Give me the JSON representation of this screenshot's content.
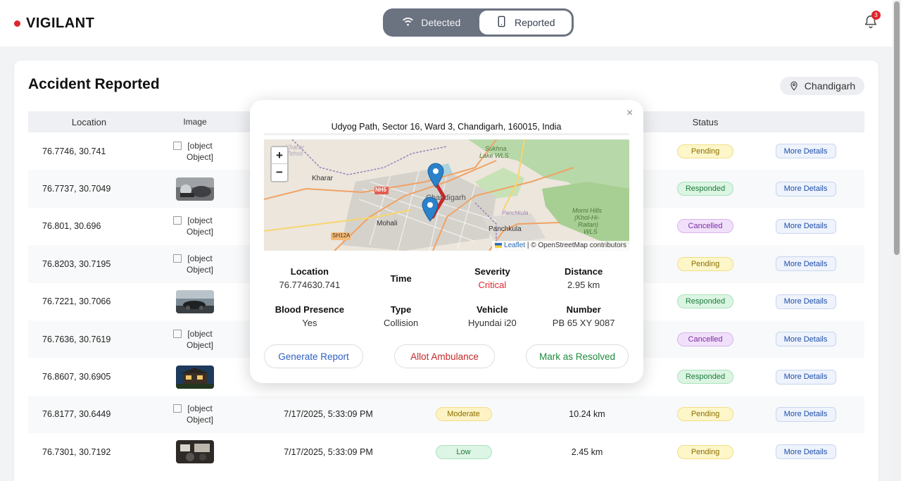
{
  "brand": {
    "name": "VIGILANT",
    "dot_color": "#e0252f"
  },
  "toggle": {
    "detected": {
      "label": "Detected",
      "icon": "wifi-icon"
    },
    "reported": {
      "label": "Reported",
      "icon": "phone-icon"
    }
  },
  "notifications": {
    "count": "3",
    "icon": "bell-icon"
  },
  "main": {
    "title": "Accident Reported",
    "city": "Chandigarh",
    "columns": {
      "location": "Location",
      "image": "Image",
      "status": "Status"
    },
    "rows": [
      {
        "location": "76.7746, 30.741",
        "image_alt": "[object Object]",
        "time": "",
        "severity": "",
        "distance": "",
        "status": "Pending",
        "action": "More Details"
      },
      {
        "location": "76.7737, 30.7049",
        "image_alt": "",
        "time": "",
        "severity": "",
        "distance": "",
        "status": "Responded",
        "action": "More Details"
      },
      {
        "location": "76.801, 30.696",
        "image_alt": "[object Object]",
        "time": "",
        "severity": "",
        "distance": "",
        "status": "Cancelled",
        "action": "More Details"
      },
      {
        "location": "76.8203, 30.7195",
        "image_alt": "[object Object]",
        "time": "",
        "severity": "",
        "distance": "",
        "status": "Pending",
        "action": "More Details"
      },
      {
        "location": "76.7221, 30.7066",
        "image_alt": "",
        "time": "",
        "severity": "",
        "distance": "",
        "status": "Responded",
        "action": "More Details"
      },
      {
        "location": "76.7636, 30.7619",
        "image_alt": "[object Object]",
        "time": "",
        "severity": "",
        "distance": "",
        "status": "Cancelled",
        "action": "More Details"
      },
      {
        "location": "76.8607, 30.6905",
        "image_alt": "",
        "time": "",
        "severity": "",
        "distance": "",
        "status": "Responded",
        "action": "More Details"
      },
      {
        "location": "76.8177, 30.6449",
        "image_alt": "[object Object]",
        "time": "7/17/2025, 5:33:09 PM",
        "severity": "Moderate",
        "distance": "10.24 km",
        "status": "Pending",
        "action": "More Details"
      },
      {
        "location": "76.7301, 30.7192",
        "image_alt": "",
        "time": "7/17/2025, 5:33:09 PM",
        "severity": "Low",
        "distance": "2.45 km",
        "status": "Pending",
        "action": "More Details"
      }
    ]
  },
  "modal": {
    "close": "×",
    "address": "Udyog Path, Sector 16, Ward 3, Chandigarh, 160015, India",
    "map": {
      "zoom_in": "+",
      "zoom_out": "−",
      "attribution_link": "Leaflet",
      "attribution_text": "| © OpenStreetMap contributors",
      "labels": {
        "kharar": "Kharar",
        "nh5": "NH5",
        "chandigarh": "Chandigarh",
        "mohali": "Mohali",
        "sh12a": "SH12A",
        "panchkula": "Panchkula",
        "panchkula_small": "Panchkula",
        "sukhna": "Sukhna",
        "sukhna2": "Lake WLS",
        "morni": "Morni Hills",
        "morni2": "(Khol-Hi-",
        "morni3": "Raitan)",
        "morni4": "WLS",
        "kharar_top": "Kharar",
        "kharar_top2": "Tehsil"
      }
    },
    "info": {
      "location_label": "Location",
      "location_value": "76.774630.741",
      "time_label": "Time",
      "severity_label": "Severity",
      "severity_value": "Critical",
      "distance_label": "Distance",
      "distance_value": "2.95 km",
      "blood_label": "Blood Presence",
      "blood_value": "Yes",
      "type_label": "Type",
      "type_value": "Collision",
      "vehicle_label": "Vehicle",
      "vehicle_value": "Hyundai i20",
      "number_label": "Number",
      "number_value": "PB 65 XY 9087"
    },
    "buttons": {
      "report": "Generate Report",
      "ambulance": "Allot Ambulance",
      "resolve": "Mark as Resolved"
    }
  },
  "colors": {
    "pending_bg": "#fdf6c9",
    "pending_fg": "#8a6d00",
    "responded_bg": "#dcf5e3",
    "responded_fg": "#1c7a3c",
    "cancelled_bg": "#f1e0fa",
    "cancelled_fg": "#7b2aa6",
    "moderate_bg": "#fdf3c4",
    "moderate_fg": "#8a6d00",
    "low_bg": "#ddf5e4",
    "low_fg": "#1c7a3c",
    "report_fg": "#2f5fc2",
    "ambulance_fg": "#c62828",
    "resolve_fg": "#1f8a3e"
  }
}
